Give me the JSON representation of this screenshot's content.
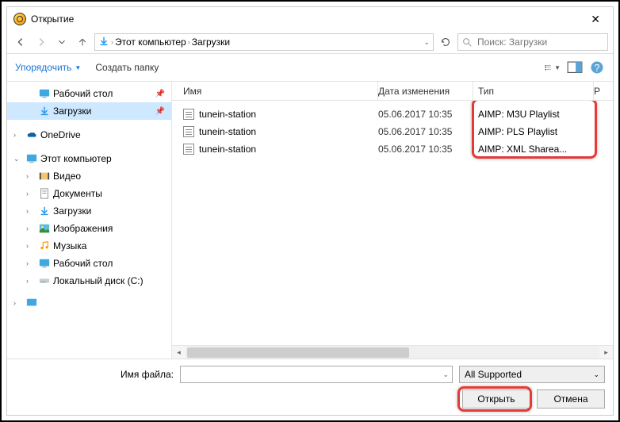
{
  "window": {
    "title": "Открытие"
  },
  "nav": {
    "breadcrumb": [
      "Этот компьютер",
      "Загрузки"
    ],
    "search_placeholder": "Поиск: Загрузки"
  },
  "toolbar": {
    "organize": "Упорядочить",
    "new_folder": "Создать папку"
  },
  "sidebar": {
    "quick1": "Рабочий стол",
    "quick2": "Загрузки",
    "onedrive": "OneDrive",
    "thispc": "Этот компьютер",
    "pc": {
      "videos": "Видео",
      "documents": "Документы",
      "downloads": "Загрузки",
      "pictures": "Изображения",
      "music": "Музыка",
      "desktop": "Рабочий стол",
      "localdisk": "Локальный диск (C:)"
    }
  },
  "columns": {
    "name": "Имя",
    "date": "Дата изменения",
    "type": "Тип",
    "extra": "Р"
  },
  "files": [
    {
      "name": "tunein-station",
      "date": "05.06.2017 10:35",
      "type": "AIMP: M3U Playlist"
    },
    {
      "name": "tunein-station",
      "date": "05.06.2017 10:35",
      "type": "AIMP: PLS Playlist"
    },
    {
      "name": "tunein-station",
      "date": "05.06.2017 10:35",
      "type": "AIMP: XML Sharea..."
    }
  ],
  "footer": {
    "filename_label": "Имя файла:",
    "filter": "All Supported",
    "open": "Открыть",
    "cancel": "Отмена"
  }
}
